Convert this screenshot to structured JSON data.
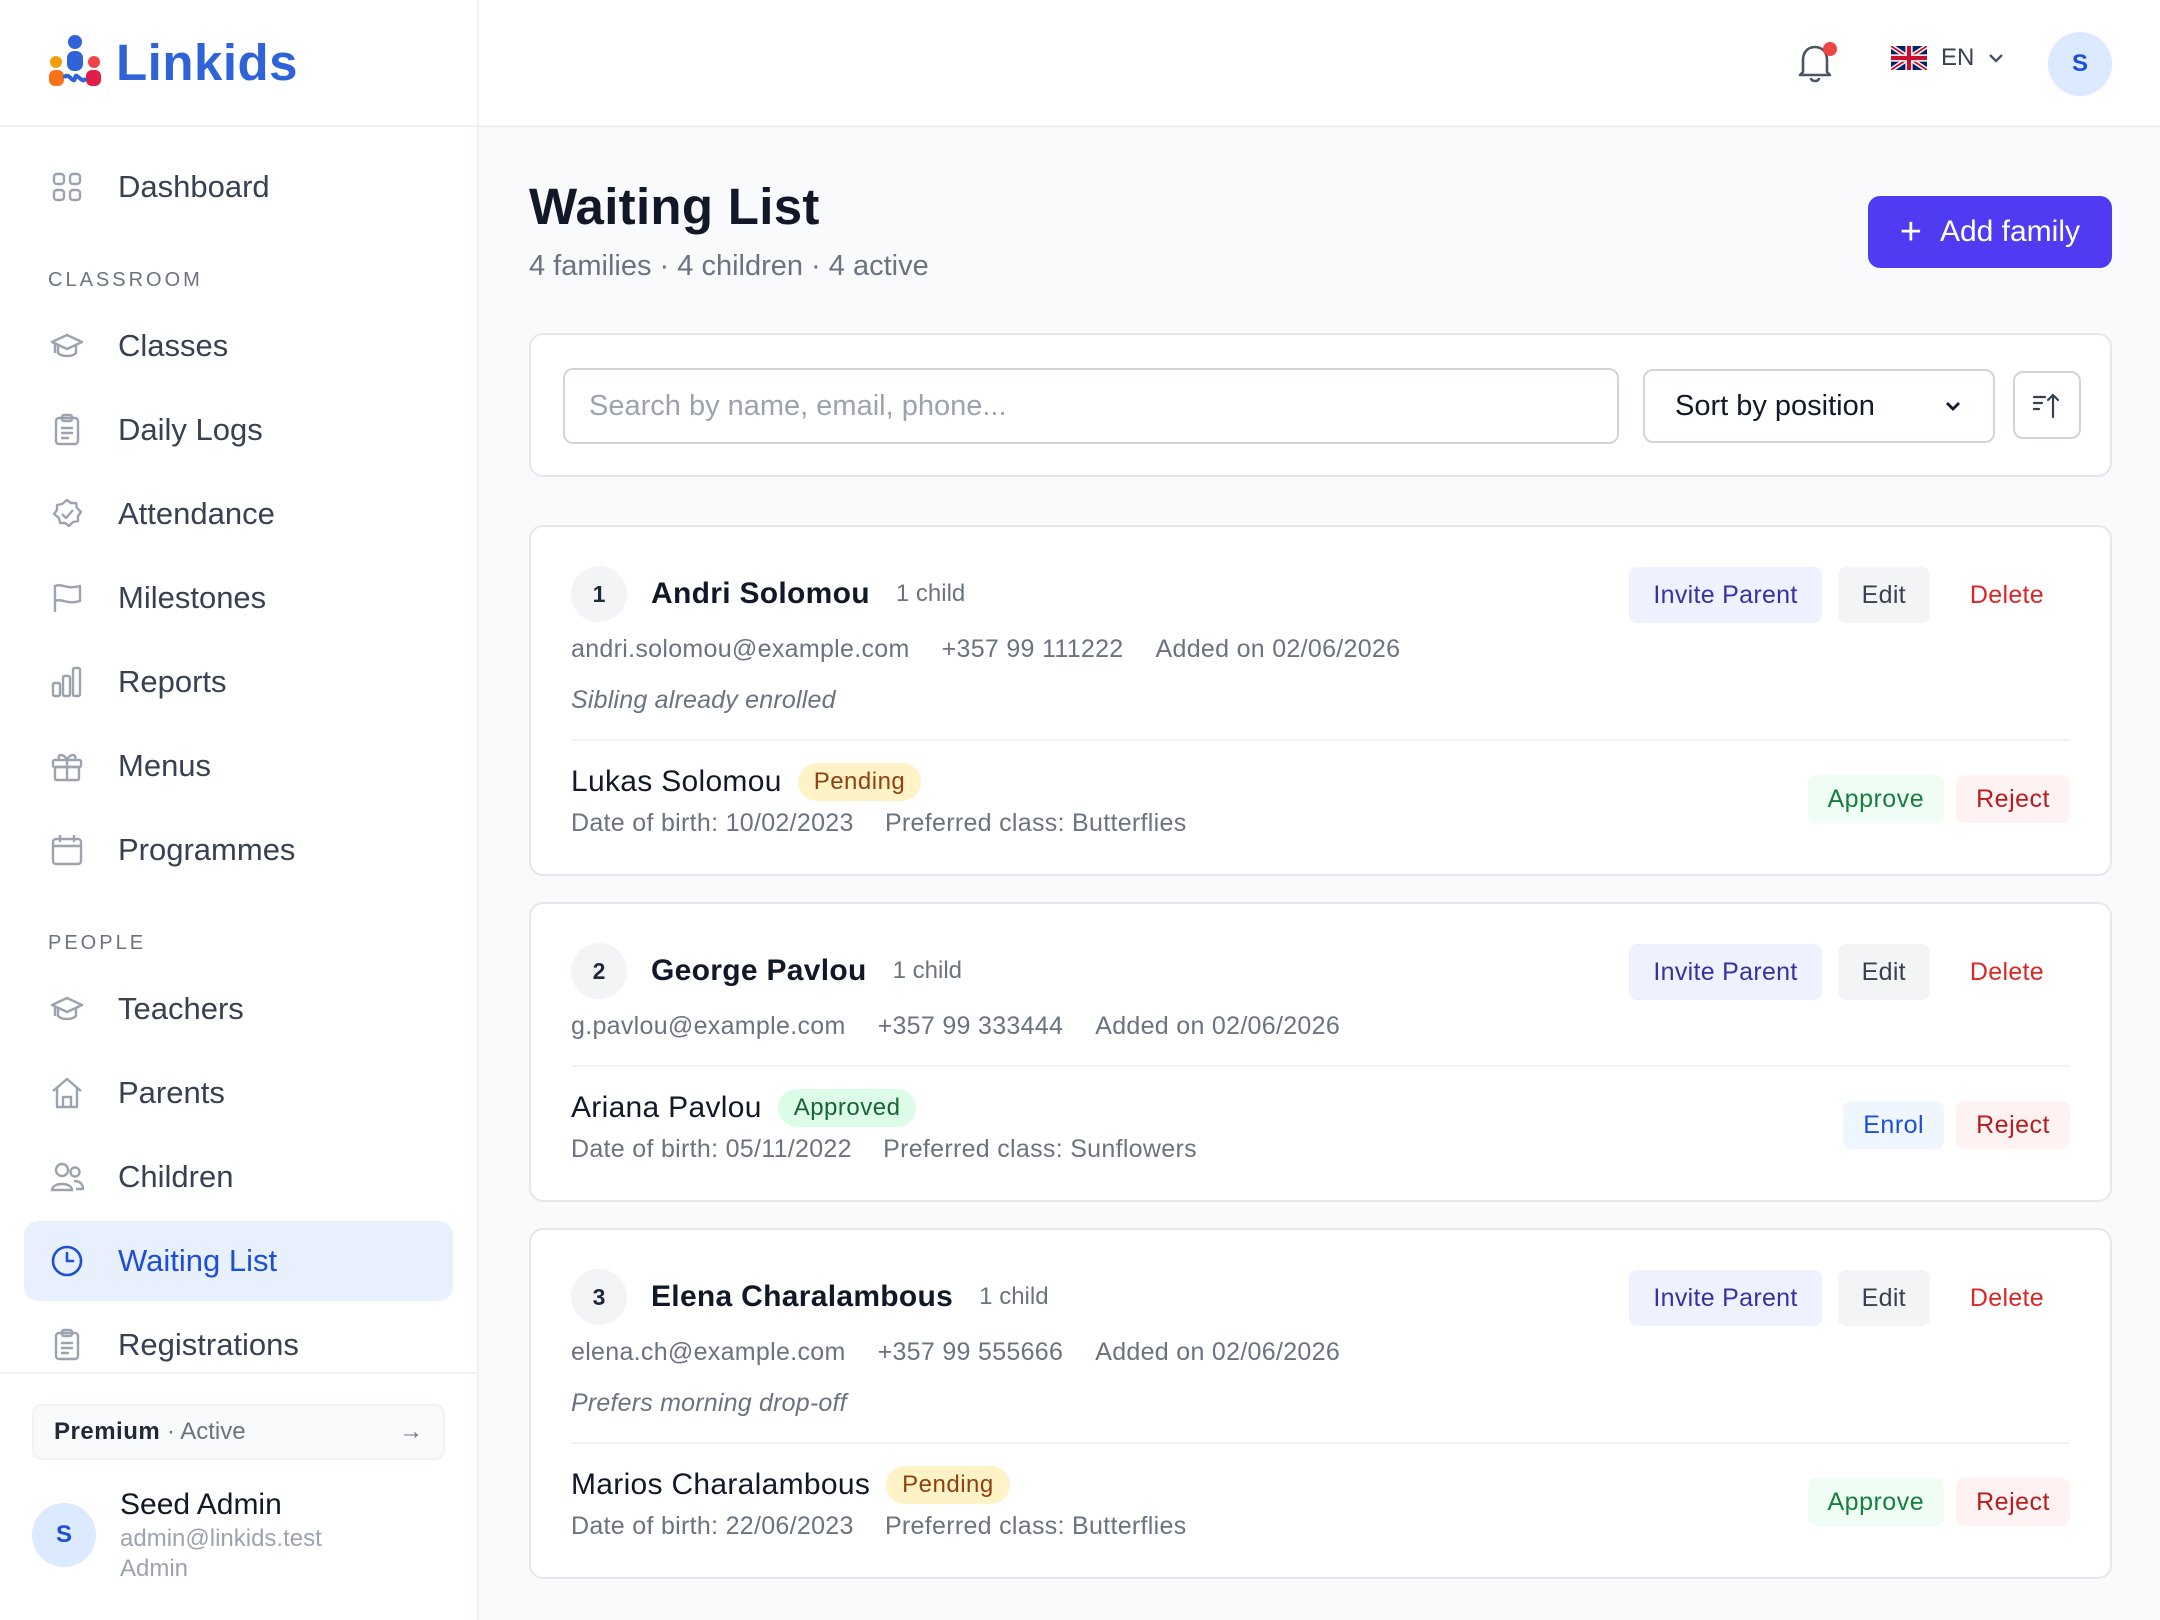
{
  "app": {
    "name": "Linkids"
  },
  "nav": {
    "dashboard": "Dashboard",
    "section_classroom": "CLASSROOM",
    "classroom_items": [
      "Classes",
      "Daily Logs",
      "Attendance",
      "Milestones",
      "Reports",
      "Menus",
      "Programmes"
    ],
    "section_people": "PEOPLE",
    "people_items": [
      "Teachers",
      "Parents",
      "Children",
      "Waiting List",
      "Registrations"
    ],
    "active": "Waiting List"
  },
  "plan": {
    "name": "Premium",
    "status": "· Active",
    "arrow": "→"
  },
  "user": {
    "initial": "S",
    "name": "Seed Admin",
    "email": "admin@linkids.test",
    "role": "Admin"
  },
  "topbar": {
    "language": "EN",
    "avatar_initial": "S",
    "has_notification": true
  },
  "page": {
    "title": "Waiting List",
    "subtitle": "4 families · 4 children · 4 active",
    "add_button": "Add family"
  },
  "filters": {
    "search_placeholder": "Search by name, email, phone...",
    "sort_value": "Sort by position"
  },
  "labels": {
    "invite": "Invite Parent",
    "edit": "Edit",
    "delete": "Delete",
    "approve": "Approve",
    "reject": "Reject",
    "enrol": "Enrol"
  },
  "families": [
    {
      "position": "1",
      "name": "Andri Solomou",
      "child_count": "1 child",
      "email": "andri.solomou@example.com",
      "phone": "+357 99 111222",
      "added": "Added on 02/06/2026",
      "note": "Sibling already enrolled",
      "child": {
        "name": "Lukas Solomou",
        "status": "Pending",
        "dob": "Date of birth: 10/02/2023",
        "class": "Preferred class: Butterflies"
      }
    },
    {
      "position": "2",
      "name": "George Pavlou",
      "child_count": "1 child",
      "email": "g.pavlou@example.com",
      "phone": "+357 99 333444",
      "added": "Added on 02/06/2026",
      "note": "",
      "child": {
        "name": "Ariana Pavlou",
        "status": "Approved",
        "dob": "Date of birth: 05/11/2022",
        "class": "Preferred class: Sunflowers"
      }
    },
    {
      "position": "3",
      "name": "Elena Charalambous",
      "child_count": "1 child",
      "email": "elena.ch@example.com",
      "phone": "+357 99 555666",
      "added": "Added on 02/06/2026",
      "note": "Prefers morning drop-off",
      "child": {
        "name": "Marios Charalambous",
        "status": "Pending",
        "dob": "Date of birth: 22/06/2023",
        "class": "Preferred class: Butterflies"
      }
    }
  ],
  "colors": {
    "primary": "#4f3cf2",
    "brand": "#2f63d8",
    "active_bg": "#e8f0fd",
    "danger": "#dc2626"
  }
}
